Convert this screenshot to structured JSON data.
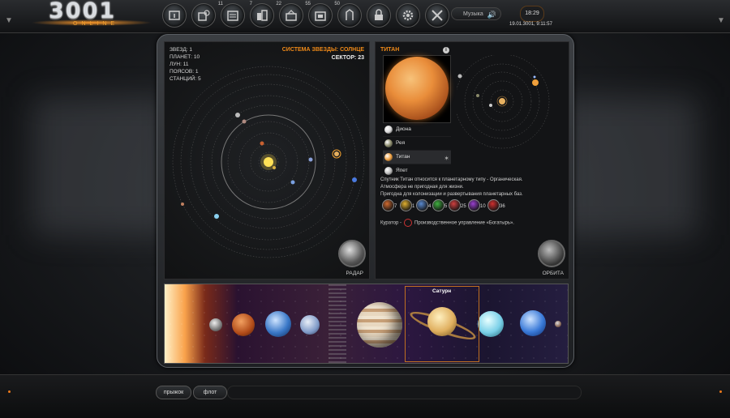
{
  "header": {
    "logo_main": "3001",
    "logo_sub": "ONLINE",
    "nav_icons": [
      {
        "name": "info-icon",
        "badge": ""
      },
      {
        "name": "gear-building-icon",
        "badge": "11"
      },
      {
        "name": "build-icon",
        "badge": "7"
      },
      {
        "name": "factory-icon",
        "badge": "22"
      },
      {
        "name": "research-icon",
        "badge": "55"
      },
      {
        "name": "storage-icon",
        "badge": "50"
      },
      {
        "name": "fleet-icon",
        "badge": ""
      },
      {
        "name": "lock-icon",
        "badge": ""
      },
      {
        "name": "settings-icon",
        "badge": ""
      },
      {
        "name": "tools-icon",
        "badge": ""
      }
    ],
    "music_label": "Музыка",
    "time": "18:29",
    "date": "19.01.3001, 9:11:57"
  },
  "system": {
    "stats": {
      "stars": "ЗВЕЗД: 1",
      "planets": "ПЛАНЕТ: 10",
      "moons": "ЛУН: 11",
      "belts": "ПОЯСОВ: 1",
      "stations": "СТАНЦИЙ: 5"
    },
    "title": "СИСТЕМА ЗВЕЗДЫ: СОЛНЦЕ",
    "sector": "СЕКТОР: 23",
    "radar_label": "РАДАР"
  },
  "moon": {
    "title": "ТИТАН",
    "list": [
      {
        "name": "Диона",
        "color": "#d8d8d8"
      },
      {
        "name": "Рея",
        "color": "#8a8a6a"
      },
      {
        "name": "Титан",
        "color": "#f0a040"
      },
      {
        "name": "Япет",
        "color": "#bbbbbb"
      }
    ],
    "description": [
      "Спутник Титан относится к планетарному типу - Органическая.",
      "Атмосфера не пригодная для жизни.",
      "Пригодна для колонизации и развертывания планетарных баз."
    ],
    "resources": [
      {
        "icon": "fire-resource-icon",
        "value": "7",
        "color": "#d06a30"
      },
      {
        "icon": "energy-resource-icon",
        "value": "1",
        "color": "#e0b030"
      },
      {
        "icon": "tech-resource-icon",
        "value": "4",
        "color": "#5a8ad0"
      },
      {
        "icon": "bio-resource-icon",
        "value": "5",
        "color": "#40b040"
      },
      {
        "icon": "crystal-resource-icon",
        "value": "25",
        "color": "#d04040"
      },
      {
        "icon": "psi-resource-icon",
        "value": "10",
        "color": "#9a40d0"
      },
      {
        "icon": "alien-resource-icon",
        "value": "36",
        "color": "#d03030"
      }
    ],
    "curator_label": "Куратор -",
    "curator_name": "Производственное управление «Богатырь».",
    "orbit_label": "ОРБИТА"
  },
  "strip": {
    "selected_label": "Сатурн"
  },
  "footer": {
    "jump_label": "прыжок",
    "fleet_label": "флот"
  }
}
